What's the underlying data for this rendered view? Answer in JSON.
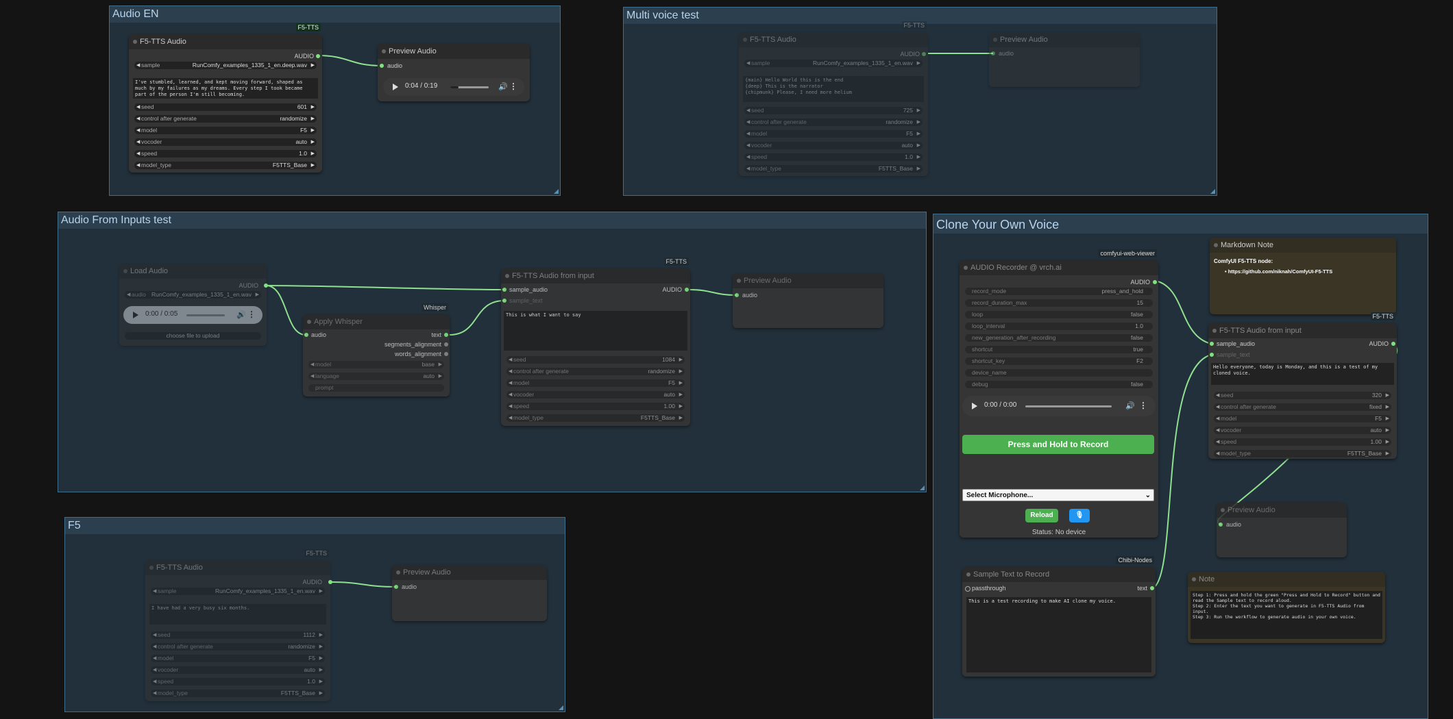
{
  "colors": {
    "link": "#8fe08f",
    "slot": "#7fe37f",
    "group_bg": "#22303b",
    "group_border": "#3f6f8c",
    "record_green": "#4caf50",
    "note_bg": "#3b3526"
  },
  "groups": {
    "audio_en": "Audio EN",
    "multi_voice": "Multi voice test",
    "audio_inputs": "Audio From Inputs test",
    "f5": "F5",
    "clone": "Clone Your Own Voice"
  },
  "audio_en": {
    "tts": {
      "badge": "F5-TTS",
      "title": "F5-TTS Audio",
      "output": "AUDIO",
      "sample_label": "sample",
      "sample_value": "RunComfy_examples_1335_1_en.deep.wav",
      "text": "I've stumbled, learned, and kept moving forward, shaped as much by my failures as my dreams. Every step I took became part of the person I'm still becoming.",
      "seed_label": "seed",
      "seed": "601",
      "control_label": "control after generate",
      "control": "randomize",
      "model_label": "model",
      "model": "F5",
      "vocoder_label": "vocoder",
      "vocoder": "auto",
      "speed_label": "speed",
      "speed": "1.0",
      "model_type_label": "model_type",
      "model_type": "F5TTS_Base"
    },
    "preview": {
      "title": "Preview Audio",
      "input": "audio",
      "time": "0:04 / 0:19",
      "progress": 0.21
    }
  },
  "multi": {
    "tts": {
      "badge": "F5-TTS",
      "title": "F5-TTS Audio",
      "output": "AUDIO",
      "sample_label": "sample",
      "sample_value": "RunComfy_examples_1335_1_en.wav",
      "text": "{main} Hello World this is the end\n{deep} This is the narrator\n{chipmunk} Please, I need more helium",
      "seed_label": "seed",
      "seed": "725",
      "control_label": "control after generate",
      "control": "randomize",
      "model_label": "model",
      "model": "F5",
      "vocoder_label": "vocoder",
      "vocoder": "auto",
      "speed_label": "speed",
      "speed": "1.0",
      "model_type_label": "model_type",
      "model_type": "F5TTS_Base"
    },
    "preview": {
      "title": "Preview Audio",
      "input": "audio"
    }
  },
  "inputs": {
    "load": {
      "title": "Load Audio",
      "output": "AUDIO",
      "audio_label": "audio",
      "audio_value": "RunComfy_examples_1335_1_en.wav",
      "time": "0:00 / 0:05",
      "progress": 0,
      "upload": "choose file to upload"
    },
    "whisper": {
      "badge": "Whisper",
      "title": "Apply Whisper",
      "input": "audio",
      "out_text": "text",
      "out_segments": "segments_alignment",
      "out_words": "words_alignment",
      "model_label": "model",
      "model": "base",
      "language_label": "language",
      "language": "auto",
      "prompt_label": "prompt"
    },
    "tts": {
      "badge": "F5-TTS",
      "title": "F5-TTS Audio from input",
      "in_sample": "sample_audio",
      "in_text": "sample_text",
      "output": "AUDIO",
      "text": "This is what I want to say",
      "seed_label": "seed",
      "seed": "1084",
      "control_label": "control after generate",
      "control": "randomize",
      "model_label": "model",
      "model": "F5",
      "vocoder_label": "vocoder",
      "vocoder": "auto",
      "speed_label": "speed",
      "speed": "1.00",
      "model_type_label": "model_type",
      "model_type": "F5TTS_Base"
    },
    "preview": {
      "title": "Preview Audio",
      "input": "audio"
    }
  },
  "f5": {
    "tts": {
      "badge": "F5-TTS",
      "title": "F5-TTS Audio",
      "output": "AUDIO",
      "sample_label": "sample",
      "sample_value": "RunComfy_examples_1335_1_en.wav",
      "text": "I have had a very busy six months.",
      "seed_label": "seed",
      "seed": "1112",
      "control_label": "control after generate",
      "control": "randomize",
      "model_label": "model",
      "model": "F5",
      "vocoder_label": "vocoder",
      "vocoder": "auto",
      "speed_label": "speed",
      "speed": "1.0",
      "model_type_label": "model_type",
      "model_type": "F5TTS_Base"
    },
    "preview": {
      "title": "Preview Audio",
      "input": "audio"
    }
  },
  "clone": {
    "recorder": {
      "badge": "comfyui-web-viewer",
      "title": "AUDIO Recorder @ vrch.ai",
      "output": "AUDIO",
      "rows": [
        [
          "record_mode",
          "press_and_hold"
        ],
        [
          "record_duration_max",
          "15"
        ],
        [
          "loop",
          "false"
        ],
        [
          "loop_interval",
          "1.0"
        ],
        [
          "new_generation_after_recording",
          "false"
        ],
        [
          "shortcut",
          "true"
        ],
        [
          "shortcut_key",
          "F2"
        ],
        [
          "device_name",
          ""
        ],
        [
          "debug",
          "false"
        ]
      ],
      "time": "0:00 / 0:00",
      "progress": 0,
      "record_button": "Press and Hold to Record",
      "mic_select": "Select Microphone...",
      "reload": "Reload",
      "status": "Status: No device"
    },
    "markdown": {
      "title": "Markdown Note",
      "heading": "ComfyUI F5-TTS node:",
      "link": "https://github.com/niknah/ComfyUI-F5-TTS"
    },
    "tts": {
      "badge": "F5-TTS",
      "title": "F5-TTS Audio from input",
      "in_sample": "sample_audio",
      "in_text": "sample_text",
      "output": "AUDIO",
      "text": "Hello everyone, today is Monday, and this is a test of my cloned voice.",
      "seed_label": "seed",
      "seed": "320",
      "control_label": "control after generate",
      "control": "fixed",
      "model_label": "model",
      "model": "F5",
      "vocoder_label": "vocoder",
      "vocoder": "auto",
      "speed_label": "speed",
      "speed": "1.00",
      "model_type_label": "model_type",
      "model_type": "F5TTS_Base"
    },
    "preview": {
      "title": "Preview Audio",
      "input": "audio"
    },
    "sample_text": {
      "badge": "Chibi-Nodes",
      "title": "Sample Text to Record",
      "input": "passthrough",
      "output": "text",
      "text": "This is a test recording to make AI clone my voice."
    },
    "note": {
      "title": "Note",
      "text": "Step 1: Press and hold the green \"Press and Hold to Record\" button and read the Sample text to record aloud.\nStep 2: Enter the text you want to generate in F5-TTS Audio from input.\nStep 3: Run the workflow to generate audio in your own voice."
    }
  }
}
